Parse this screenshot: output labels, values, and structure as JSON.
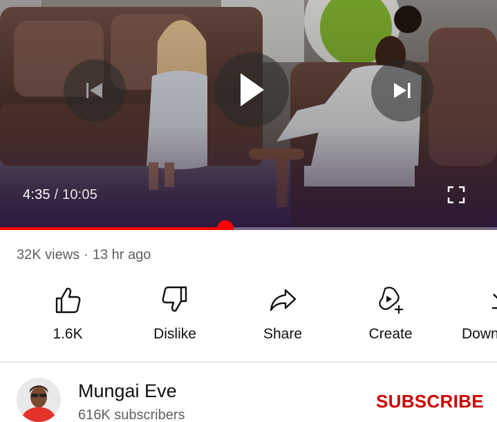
{
  "player": {
    "current_time": "4:35",
    "separator": "/",
    "duration": "10:05",
    "progress_fraction": 0.453,
    "accent_color": "#ff0000",
    "icons": [
      "previous-icon",
      "play-icon",
      "next-icon",
      "fullscreen-icon"
    ]
  },
  "video": {
    "views": "32K views",
    "dot": "·",
    "age": "13 hr ago"
  },
  "actions": {
    "like": {
      "label": "1.6K",
      "icon": "thumbs-up-icon"
    },
    "dislike": {
      "label": "Dislike",
      "icon": "thumbs-down-icon"
    },
    "share": {
      "label": "Share",
      "icon": "share-arrow-icon"
    },
    "create": {
      "label": "Create",
      "icon": "create-plus-icon"
    },
    "download": {
      "label": "Down",
      "icon": "download-icon"
    }
  },
  "channel": {
    "name": "Mungai Eve",
    "subscribers": "616K subscribers",
    "subscribe_label": "SUBSCRIBE",
    "subscribe_color": "#cc0000"
  }
}
